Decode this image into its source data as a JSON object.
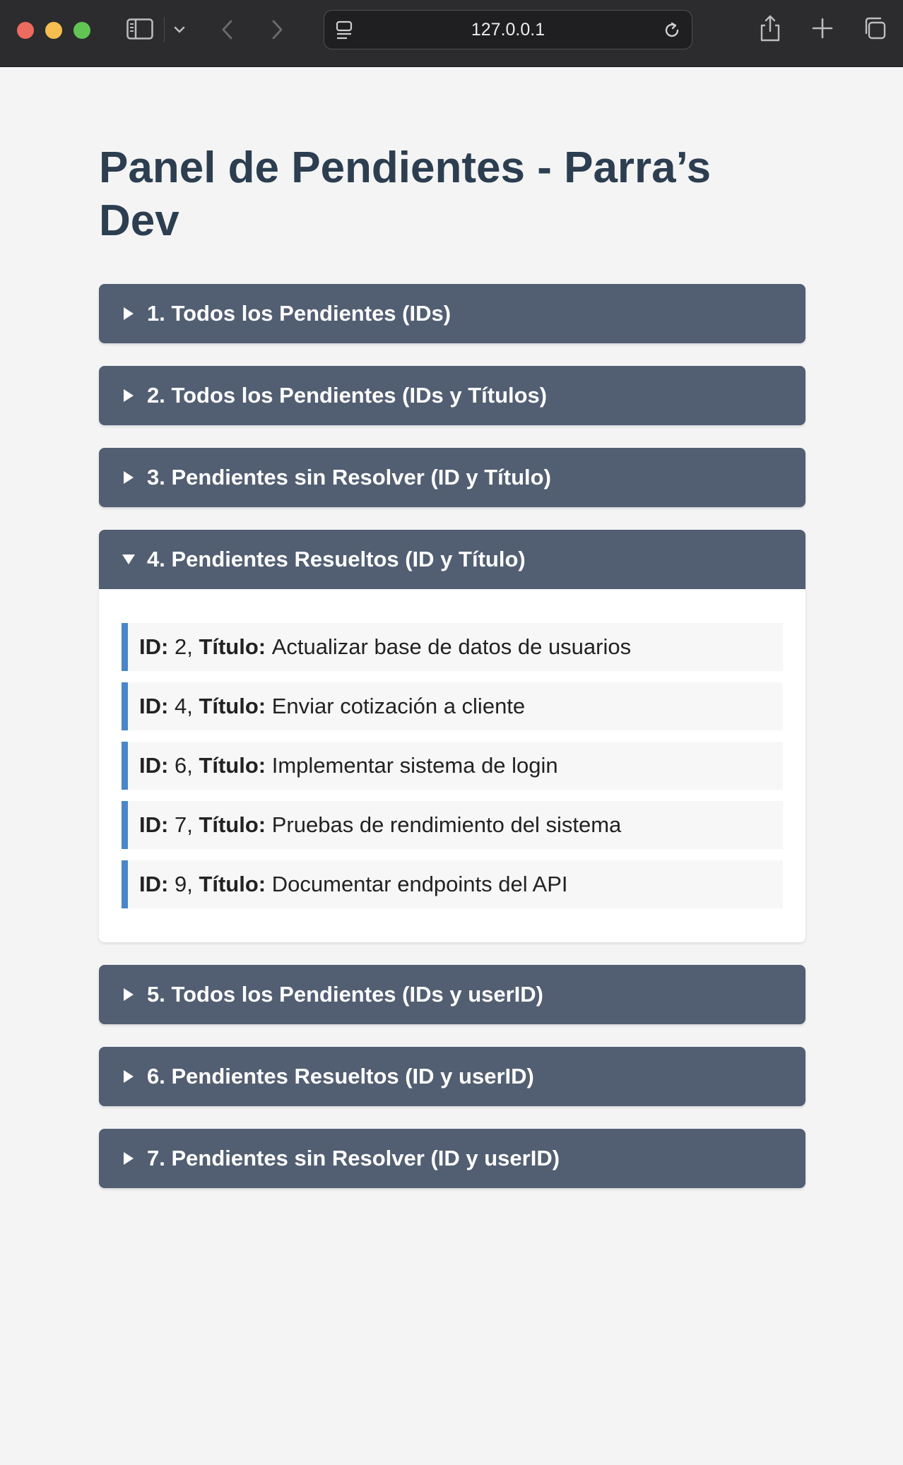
{
  "browser": {
    "url": "127.0.0.1"
  },
  "page": {
    "title": "Panel de Pendientes - Parra’s Dev"
  },
  "labels": {
    "id": "ID:",
    "titulo": "Título:"
  },
  "sections": [
    {
      "label": "1. Todos los Pendientes (IDs)",
      "expanded": false
    },
    {
      "label": "2. Todos los Pendientes (IDs y Títulos)",
      "expanded": false
    },
    {
      "label": "3. Pendientes sin Resolver (ID y Título)",
      "expanded": false
    },
    {
      "label": "4. Pendientes Resueltos (ID y Título)",
      "expanded": true,
      "items": [
        {
          "id": "2",
          "title": "Actualizar base de datos de usuarios"
        },
        {
          "id": "4",
          "title": "Enviar cotización a cliente"
        },
        {
          "id": "6",
          "title": "Implementar sistema de login"
        },
        {
          "id": "7",
          "title": "Pruebas de rendimiento del sistema"
        },
        {
          "id": "9",
          "title": "Documentar endpoints del API"
        }
      ]
    },
    {
      "label": "5. Todos los Pendientes (IDs y userID)",
      "expanded": false
    },
    {
      "label": "6. Pendientes Resueltos (ID y userID)",
      "expanded": false
    },
    {
      "label": "7. Pendientes sin Resolver (ID y userID)",
      "expanded": false
    }
  ],
  "colors": {
    "summary_bg": "#525e72",
    "title": "#2c3e50",
    "item_accent": "#4a86c8",
    "page_bg": "#f4f4f5"
  },
  "icons": [
    "sidebar-icon",
    "chevron-down-icon",
    "back-icon",
    "forward-icon",
    "page-icon",
    "reload-icon",
    "share-icon",
    "plus-icon",
    "tabs-icon",
    "triangle-right-icon",
    "triangle-down-icon"
  ]
}
